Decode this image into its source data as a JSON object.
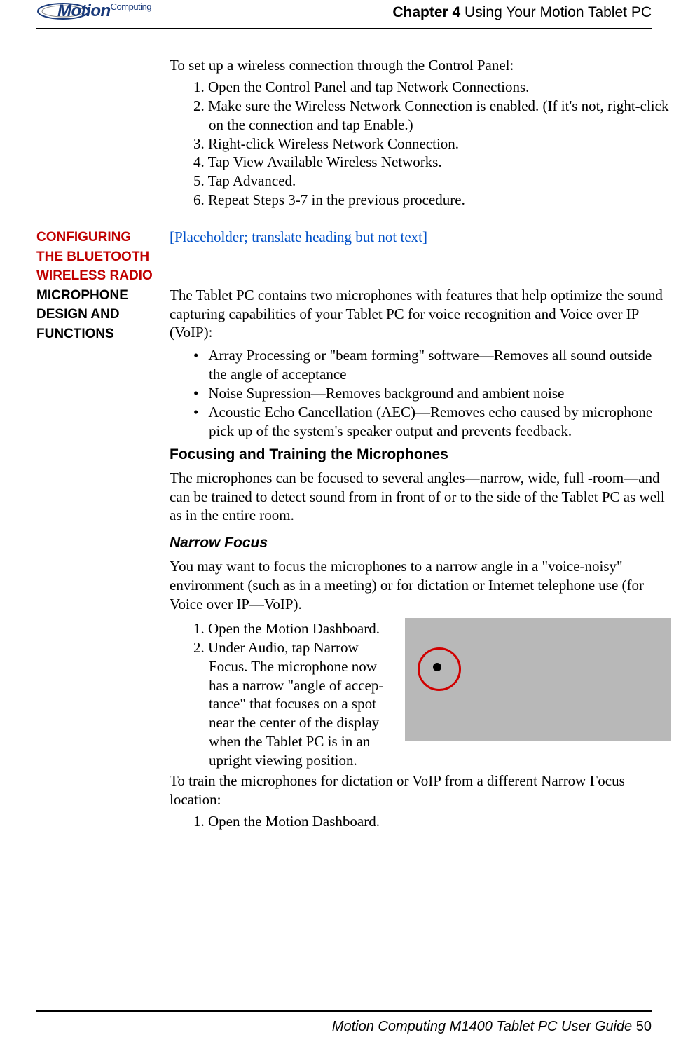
{
  "header": {
    "logo_text": "Motion",
    "logo_sub": "Computing",
    "chapter_label": "Chapter 4",
    "chapter_title": " Using Your Motion Tablet PC"
  },
  "intro_para": "To set up a wireless connection through the Control Panel:",
  "steps_a": [
    "1. Open the Control Panel and tap Network Connections.",
    "2. Make sure the Wireless Network Connection is enabled. (If it's not, right-click on the connection and tap Enable.)",
    "3. Right-click Wireless Network Connection.",
    "4. Tap View Available Wireless Networks.",
    "5. Tap Advanced.",
    "6. Repeat Steps 3-7 in the previous procedure."
  ],
  "section_bt": {
    "heading": "CONFIGURING THE BLUETOOTH WIRELESS RADIO",
    "body": "[Placeholder; translate heading but not text]"
  },
  "section_mic": {
    "heading": "MICROPHONE DESIGN AND FUNCTIONS",
    "intro": "The Tablet PC contains two microphones with features that help optimize the sound capturing capabilities of your Tablet PC for voice recognition and Voice over IP (VoIP):",
    "bullets": [
      "Array Processing or \"beam forming\" software—Removes all sound out­side the angle of acceptance",
      "Noise Supression—Removes background and ambient noise",
      "Acoustic Echo Cancellation (AEC)—Removes echo caused by micro­phone pick up of the system's speaker output and prevents feedback."
    ],
    "sub1_title": "Focusing and Training the Microphones",
    "sub1_body": "The microphones can be focused to several angles—narrow, wide, full -room—and can be trained to detect sound from in front of or to the side of the Tablet PC as well as in the entire room.",
    "sub2_title": "Narrow Focus",
    "sub2_body": "You may want to focus the microphones to a narrow angle in a \"voice-noisy\" environment (such as in a meeting) or for dictation or Internet telephone use (for Voice over IP—VoIP).",
    "narrow_steps": [
      "1. Open the Motion Dashboard.",
      "2. Under Audio, tap Narrow Focus. The microphone now has a narrow \"angle of accep­tance\" that focuses on a spot near the center of the display when the Tablet PC is in an upright viewing position."
    ],
    "train_intro": "To train the microphones for dictation or VoIP from a different Narrow Focus location:",
    "train_steps": [
      "1. Open the Motion Dashboard."
    ]
  },
  "footer": {
    "text": "Motion Computing M1400 Tablet PC User Guide ",
    "page": "50"
  }
}
